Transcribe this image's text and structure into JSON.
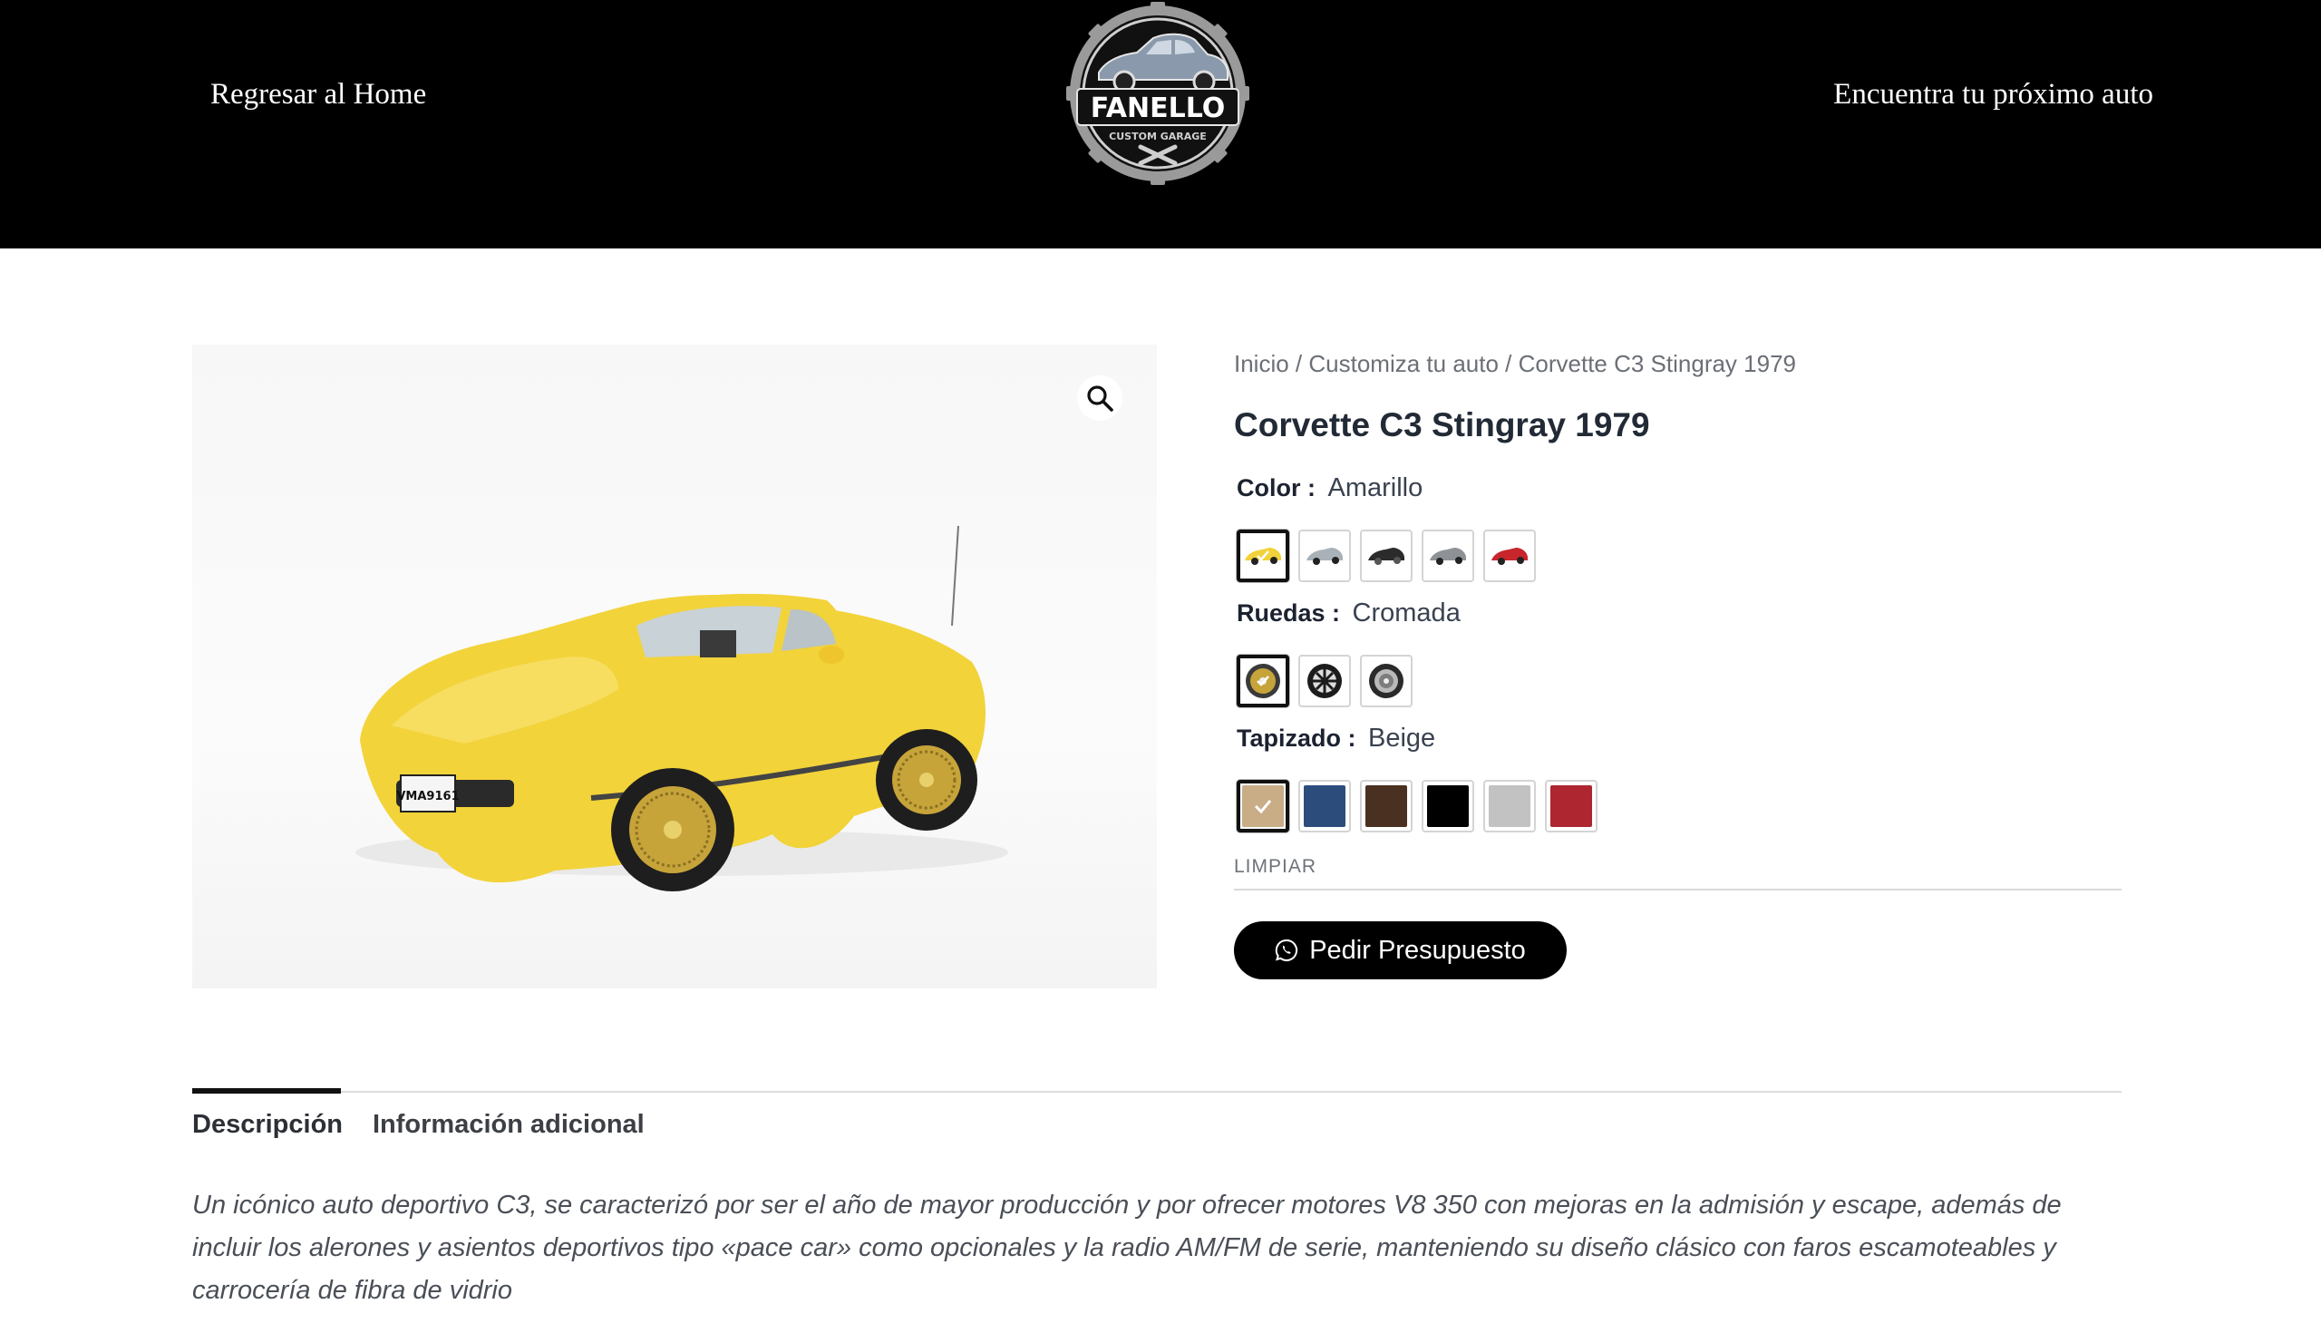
{
  "header": {
    "back_link": "Regresar al Home",
    "find_link": "Encuentra tu próximo auto",
    "logo": {
      "brand": "FANELLO",
      "tagline": "CUSTOM GARAGE"
    }
  },
  "breadcrumb": {
    "items": [
      "Inicio",
      "Customiza tu auto",
      "Corvette C3 Stingray 1979"
    ],
    "separator": " / "
  },
  "product": {
    "title": "Corvette C3 Stingray 1979",
    "image_icon": "yellow-corvette-photo",
    "zoom_icon": "magnifier-icon"
  },
  "attributes": {
    "color": {
      "label": "Color",
      "selected": "Amarillo",
      "swatch_colors": [
        "#f2d23a",
        "#a9b2b8",
        "#2b2b2b",
        "#8e9296",
        "#c8262c"
      ]
    },
    "ruedas": {
      "label": "Ruedas",
      "selected": "Cromada",
      "swatch_icons": [
        "gold-wire-wheel-icon",
        "black-spoke-wheel-icon",
        "chrome-wheel-icon"
      ]
    },
    "tapizado": {
      "label": "Tapizado",
      "selected": "Beige",
      "swatch_colors": [
        "#c8ad86",
        "#2c4d7c",
        "#4a3020",
        "#000000",
        "#c2c2c2",
        "#ad2630"
      ]
    },
    "separator": " : ",
    "clear_label": "LIMPIAR"
  },
  "cta": {
    "label": "Pedir Presupuesto",
    "icon": "whatsapp-icon"
  },
  "tabs": [
    {
      "label": "Descripción",
      "active": true
    },
    {
      "label": "Información adicional",
      "active": false
    }
  ],
  "description": "Un icónico auto deportivo C3, se caracterizó por ser el año de mayor producción y por ofrecer motores V8 350 con mejoras en la admisión y escape, además de incluir los alerones y asientos deportivos tipo «pace car» como opcionales y la radio AM/FM de serie, manteniendo su diseño clásico con faros escamoteables y carrocería de fibra de vidrio"
}
